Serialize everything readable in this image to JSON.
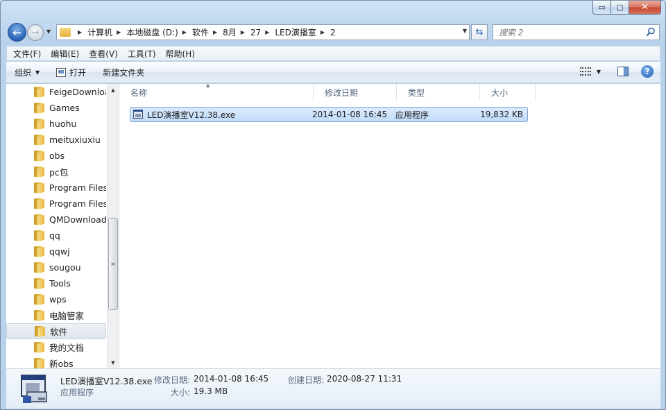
{
  "window": {
    "caption": {
      "minimize": "▭",
      "maximize": "▢",
      "close": "✕"
    }
  },
  "nav": {
    "back": "←",
    "forward": "→",
    "breadcrumbs": [
      "计算机",
      "本地磁盘 (D:)",
      "软件",
      "8月",
      "27",
      "LED演播室",
      "2"
    ],
    "search_placeholder": "搜索 2"
  },
  "menu": [
    "文件(F)",
    "编辑(E)",
    "查看(V)",
    "工具(T)",
    "帮助(H)"
  ],
  "commands": {
    "organize": "组织",
    "open": "打开",
    "new_folder": "新建文件夹"
  },
  "tree": [
    {
      "label": "FeigeDownloa",
      "selected": false
    },
    {
      "label": "Games",
      "selected": false
    },
    {
      "label": "huohu",
      "selected": false
    },
    {
      "label": "meituxiuxiu",
      "selected": false
    },
    {
      "label": "obs",
      "selected": false
    },
    {
      "label": "pc包",
      "selected": false
    },
    {
      "label": "Program Files",
      "selected": false
    },
    {
      "label": "Program Files",
      "selected": false
    },
    {
      "label": "QMDownload",
      "selected": false
    },
    {
      "label": "qq",
      "selected": false
    },
    {
      "label": "qqwj",
      "selected": false
    },
    {
      "label": "sougou",
      "selected": false
    },
    {
      "label": "Tools",
      "selected": false
    },
    {
      "label": "wps",
      "selected": false
    },
    {
      "label": "电脑管家",
      "selected": false
    },
    {
      "label": "软件",
      "selected": true
    },
    {
      "label": "我的文档",
      "selected": false
    },
    {
      "label": "新obs",
      "selected": false
    }
  ],
  "columns": [
    {
      "label": "名称",
      "width": 280
    },
    {
      "label": "修改日期",
      "width": 120
    },
    {
      "label": "类型",
      "width": 120
    },
    {
      "label": "大小",
      "width": 80
    }
  ],
  "files": [
    {
      "name": "LED演播室V12.38.exe",
      "modified": "2014-01-08 16:45",
      "type": "应用程序",
      "size": "19,832 KB"
    }
  ],
  "details": {
    "name": "LED演播室V12.38.exe",
    "type": "应用程序",
    "modified_label": "修改日期:",
    "modified_value": "2014-01-08 16:45",
    "created_label": "创建日期:",
    "created_value": "2020-08-27 11:31",
    "size_label": "大小:",
    "size_value": "19.3 MB"
  }
}
